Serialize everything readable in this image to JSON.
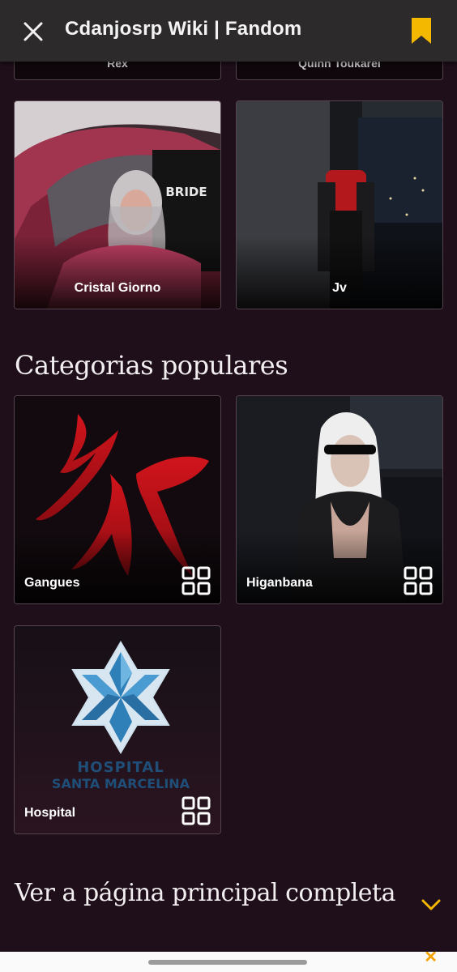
{
  "header": {
    "title": "Cdanjosrp Wiki | Fandom",
    "close_icon": "close-icon",
    "bookmark_icon": "bookmark-icon",
    "accent": "#f5b800"
  },
  "partial_cards": [
    {
      "label": "Rex"
    },
    {
      "label": "Quinn Toukarel"
    }
  ],
  "character_cards": [
    {
      "label": "Cristal Giorno"
    },
    {
      "label": "Jv"
    }
  ],
  "popular_categories": {
    "title": "Categorias populares",
    "items": [
      {
        "label": "Gangues"
      },
      {
        "label": "Higanbana"
      },
      {
        "label": "Hospital"
      }
    ]
  },
  "hospital_logo_text": {
    "line1": "HOSPITAL",
    "line2": "SANTA MARCELINA"
  },
  "car_seat_text": "BRIDE",
  "footer": {
    "link_label": "Ver a página principal completa",
    "chevron_icon": "chevron-down-icon"
  }
}
